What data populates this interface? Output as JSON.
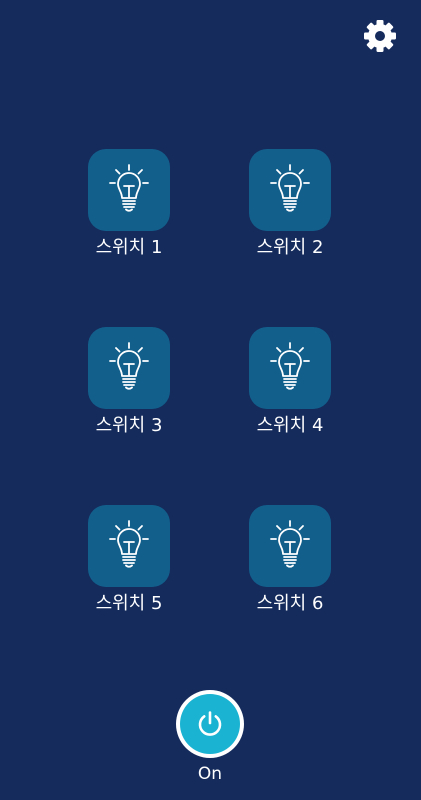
{
  "settings": {
    "icon": "gear-icon"
  },
  "switches": [
    {
      "label": "스위치 1",
      "icon": "lightbulb-icon"
    },
    {
      "label": "스위치 2",
      "icon": "lightbulb-icon"
    },
    {
      "label": "스위치 3",
      "icon": "lightbulb-icon"
    },
    {
      "label": "스위치 4",
      "icon": "lightbulb-icon"
    },
    {
      "label": "스위치 5",
      "icon": "lightbulb-icon"
    },
    {
      "label": "스위치 6",
      "icon": "lightbulb-icon"
    }
  ],
  "power": {
    "label": "On",
    "icon": "power-icon"
  },
  "colors": {
    "background": "#142b5c",
    "tile": "#135f8c",
    "power_accent": "#1ab3d1"
  }
}
